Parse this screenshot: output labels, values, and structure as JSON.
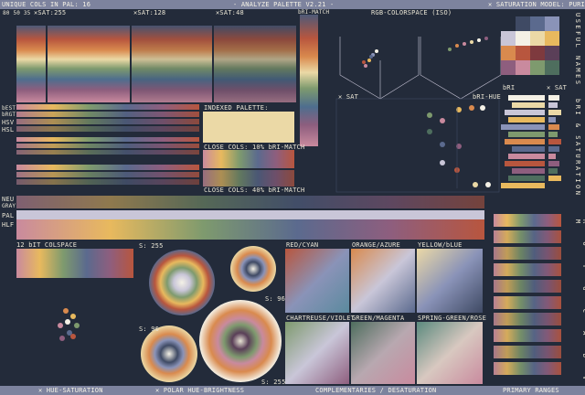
{
  "header": {
    "unique_cols": "UNIQUE COLS IN PAL: 16",
    "title": "- ANALYZE PALETTE V2.21 -",
    "sat_model": "✕ SATURATION MODEL: PURISM"
  },
  "hue_strip": {
    "sat_labels_small": [
      "80",
      "50",
      "35"
    ],
    "sat255": "✕SAT:255",
    "sat128": "✕SAT:128",
    "sat48": "✕SAT:48",
    "bri_match": "bRI-MATCH"
  },
  "colorspace": {
    "title": "RGB-COLORSPACE (ISO)",
    "sat_label": "✕ SAT",
    "bri_hue_label": "bRI-HUE",
    "bri_label": "bRI",
    "sat_label2": "✕ SAT"
  },
  "left_labels": {
    "hsl": "HSL",
    "hsv": "HSV",
    "best": "bEST",
    "bright": "bRGT",
    "neu": "NEU",
    "gray": "GRAY",
    "pal": "PAL",
    "hlf": "HLF"
  },
  "indexed": {
    "title": "INDEXED PALETTE:",
    "close_10": "CLOSE COLS: 10% bRI-MATCH",
    "close_40": "CLOSE COLS: 40% bRI-MATCH"
  },
  "side_labels": {
    "useful_names": "USEFUL NAMES",
    "bri_sat": "bRI & SATURATION",
    "roygcbvm": "R O Y G C A B V M"
  },
  "bottom": {
    "colspace_12bit": "12 bIT COLSPACE",
    "s255_a": "S: 255",
    "s96_a": "S: 96",
    "s96_b": "S: 96",
    "s255_b": "S: 255",
    "complementaries": [
      {
        "label": "RED/CYAN"
      },
      {
        "label": "ORANGE/AZURE"
      },
      {
        "label": "YELLOW/bLUE"
      },
      {
        "label": "CHARTREUSE/VIOLET"
      },
      {
        "label": "GREEN/MAGENTA"
      },
      {
        "label": "SPRING-GREEN/ROSE"
      }
    ]
  },
  "footer": {
    "hue_sat": "✕ HUE-SATURATION",
    "polar": "✕ POLAR HUE-BRIGHTNESS",
    "complementaries": "COMPLEMENTARIES / DESATURATION",
    "primary_ranges": "PRIMARY RANGES"
  },
  "palette": {
    "colors": [
      "#232b3a",
      "#3f4a64",
      "#5b6a8e",
      "#8a93b8",
      "#c9c6d8",
      "#f4f1e6",
      "#ebd9a6",
      "#e8b95e",
      "#d98a4e",
      "#b8563e",
      "#7e3a3e",
      "#5a3f58",
      "#8e5e7e",
      "#c98a9e",
      "#7e9a6e",
      "#4e6e5e"
    ]
  }
}
